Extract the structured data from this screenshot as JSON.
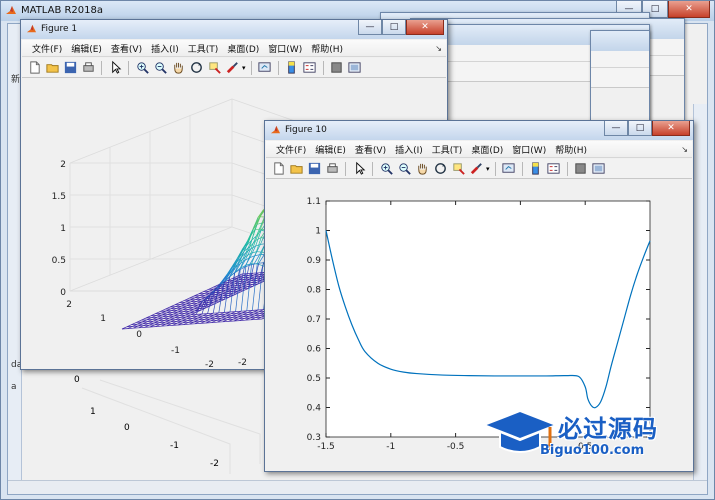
{
  "main_window": {
    "title": "MATLAB R2018a",
    "stub_texts": [
      "新",
      "da",
      "a",
      "0"
    ],
    "buttons": [
      "—",
      "□",
      "✕"
    ]
  },
  "menu_items": [
    "文件(F)",
    "编辑(E)",
    "查看(V)",
    "插入(I)",
    "工具(T)",
    "桌面(D)",
    "窗口(W)",
    "帮助(H)"
  ],
  "toolbar_icons": [
    "new-file-icon",
    "open-folder-icon",
    "save-icon",
    "print-icon",
    "pointer-icon",
    "zoom-in-icon",
    "zoom-out-icon",
    "pan-hand-icon",
    "rotate-3d-icon",
    "data-cursor-icon",
    "brush-icon",
    "link-plot-icon",
    "colorbar-icon",
    "legend-icon",
    "hide-plot-tools-icon",
    "show-plot-tools-icon"
  ],
  "figure1": {
    "title": "Figure 1",
    "z_ticks": [
      "0",
      "0.5",
      "1",
      "1.5",
      "2"
    ],
    "y_ticks": [
      "2",
      "1",
      "0",
      "-1",
      "-2"
    ],
    "x_ticks": [
      "-2"
    ]
  },
  "figure10": {
    "title": "Figure 10"
  },
  "background_axes": {
    "z_ticks": [
      "0",
      "-1",
      "-2"
    ],
    "y_ticks": [
      "2",
      "1",
      "0",
      "-1",
      "-2"
    ]
  },
  "watermark": {
    "brand": "必过源码",
    "url": "Biguo100.com"
  },
  "colors": {
    "line": "#0072BD",
    "titlebar": "#c4d6ec",
    "close": "#c7412b"
  },
  "chart_data": {
    "type": "line",
    "x": [
      -1.5,
      -1.45,
      -1.4,
      -1.35,
      -1.3,
      -1.25,
      -1.2,
      -1.1,
      -1.0,
      -0.9,
      -0.8,
      -0.6,
      -0.4,
      -0.2,
      0.0,
      0.2,
      0.35,
      0.45,
      0.5,
      0.52,
      0.55,
      0.58,
      0.62,
      0.66,
      0.7,
      0.75,
      0.8,
      0.85,
      0.9,
      0.95,
      1.0
    ],
    "y": [
      1.0,
      0.9,
      0.81,
      0.74,
      0.68,
      0.63,
      0.59,
      0.55,
      0.53,
      0.52,
      0.515,
      0.51,
      0.508,
      0.507,
      0.507,
      0.507,
      0.508,
      0.505,
      0.47,
      0.43,
      0.405,
      0.4,
      0.42,
      0.47,
      0.54,
      0.62,
      0.7,
      0.78,
      0.85,
      0.91,
      0.965
    ],
    "xlim": [
      -1.5,
      1.0
    ],
    "ylim": [
      0.3,
      1.1
    ],
    "x_ticks": [
      -1.5,
      -1,
      -0.5,
      0,
      0.5
    ],
    "x_tick_labels": [
      "-1.5",
      "-1",
      "-0.5",
      "0",
      "0.5"
    ],
    "y_ticks": [
      0.3,
      0.4,
      0.5,
      0.6,
      0.7,
      0.8,
      0.9,
      1,
      1.1
    ],
    "y_tick_labels": [
      "0.3",
      "0.4",
      "0.5",
      "0.6",
      "0.7",
      "0.8",
      "0.9",
      "1",
      "1.1"
    ],
    "grid": false
  }
}
